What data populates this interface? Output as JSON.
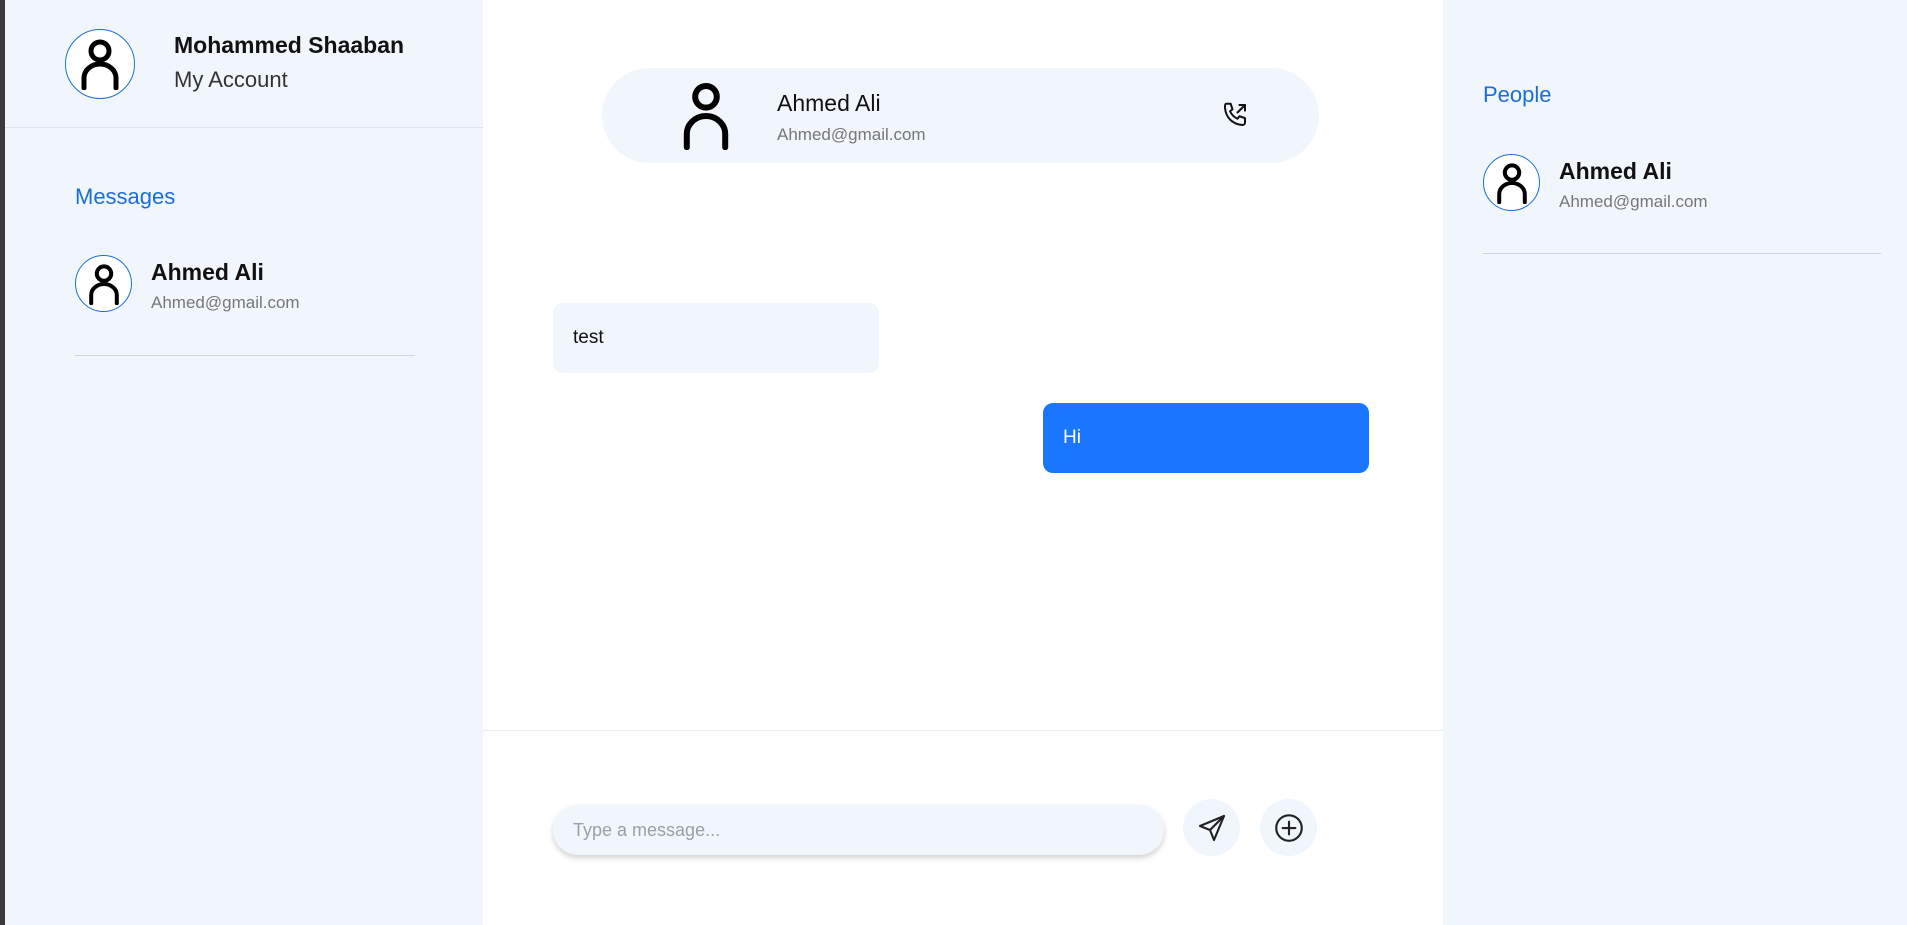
{
  "account": {
    "name": "Mohammed Shaaban",
    "subtitle": "My Account"
  },
  "messages_panel": {
    "title": "Messages",
    "items": [
      {
        "name": "Ahmed Ali",
        "email": "Ahmed@gmail.com"
      }
    ]
  },
  "chat": {
    "header": {
      "name": "Ahmed Ali",
      "email": "Ahmed@gmail.com"
    },
    "messages": [
      {
        "direction": "incoming",
        "text": "test"
      },
      {
        "direction": "outgoing",
        "text": "Hi"
      }
    ],
    "composer": {
      "placeholder": "Type a message...",
      "value": ""
    }
  },
  "people_panel": {
    "title": "People",
    "items": [
      {
        "name": "Ahmed Ali",
        "email": "Ahmed@gmail.com"
      }
    ]
  },
  "icons": {
    "avatar": "user-icon",
    "call": "phone-outgoing-icon",
    "send": "send-icon",
    "add": "plus-circle-icon"
  },
  "colors": {
    "accent": "#1a6fd6",
    "outgoing_bubble": "#1a76ff",
    "panel_bg": "#f1f5fc"
  }
}
